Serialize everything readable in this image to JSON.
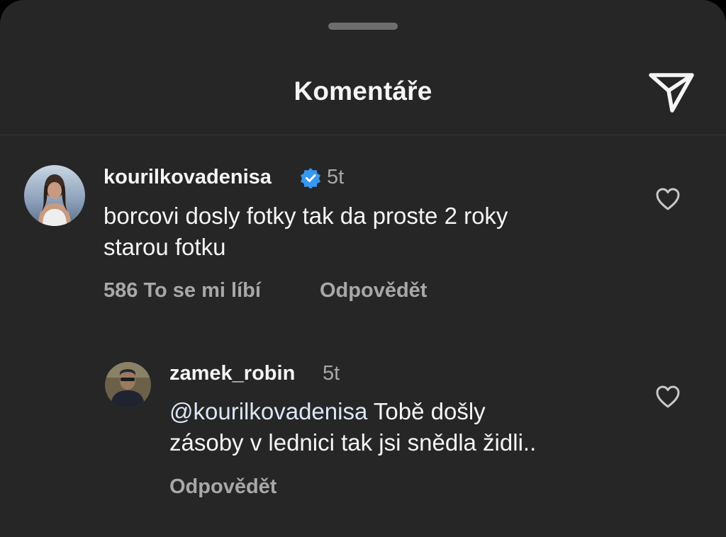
{
  "header": {
    "title": "Komentáře",
    "share_icon": "paper-plane-icon"
  },
  "comments": [
    {
      "username": "kourilkovadenisa",
      "verified": true,
      "time": "5t",
      "text": "borcovi dosly fotky tak da proste 2 roky starou fotku",
      "text_line1": "borcovi dosly fotky tak da proste 2 roky",
      "text_line2": "starou fotku",
      "likes_label": "586 To se mi líbí",
      "reply_label": "Odpovědět",
      "like_icon": "heart-outline-icon"
    }
  ],
  "replies": [
    {
      "username": "zamek_robin",
      "time": "5t",
      "mention": "@kourilkovadenisa",
      "text_line1_rest": " Tobě došly",
      "text_line2": "zásoby v lednici tak jsi snědla židli..",
      "reply_label": "Odpovědět",
      "like_icon": "heart-outline-icon"
    }
  ],
  "colors": {
    "background": "#262626",
    "primary_text": "#f5f5f5",
    "secondary_text": "#a8a8a8",
    "verified_badge": "#3897f0"
  }
}
